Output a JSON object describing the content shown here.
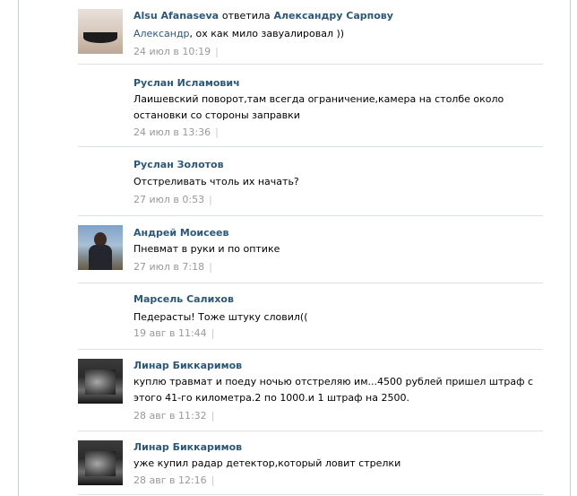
{
  "comments": [
    {
      "author": "Alsu Afanaseva",
      "action": "ответила",
      "reply_to": "Александру Сарпову",
      "mention": "Александр",
      "text": ", ох как мило завуалировал ))",
      "date": "24 июл в 10:19",
      "separator": "|",
      "avatar": "photo-avatar"
    },
    {
      "author": "Руслан Исламович",
      "text": "Лаишевский поворот,там всегда ограничение,камера на столбе около остановки со стороны заправки",
      "date": "24 июл в 13:36",
      "separator": "|"
    },
    {
      "author": "Руслан Золотов",
      "text": "Отстреливать чтоль их начать?",
      "date": "27 июл в 0:53",
      "separator": "|"
    },
    {
      "author": "Андрей Моисеев",
      "text": "Пневмат в руки и по оптике",
      "date": "27 июл в 7:18",
      "separator": "|",
      "avatar": "photo-avatar"
    },
    {
      "author": "Марсель Салихов",
      "text": "Педерасты! Тоже штуку словил((",
      "date": "19 авг в 11:44",
      "separator": "|"
    },
    {
      "author": "Линар Биккаримов",
      "text": "куплю травмат и поеду ночью отстреляю им...4500 рублей пришел штраф с этого 41-го километра.2 по 1000.и 1 штраф на 2500.",
      "date": "28 авг в 11:32",
      "separator": "|",
      "avatar": "photo-avatar"
    },
    {
      "author": "Линар Биккаримов",
      "text": "уже купил радар детектор,который ловит стрелки",
      "date": "28 авг в 12:16",
      "separator": "|",
      "avatar": "photo-avatar"
    }
  ],
  "colors": {
    "link": "#2b587a",
    "meta": "#999999",
    "divider": "#dae1e8"
  }
}
